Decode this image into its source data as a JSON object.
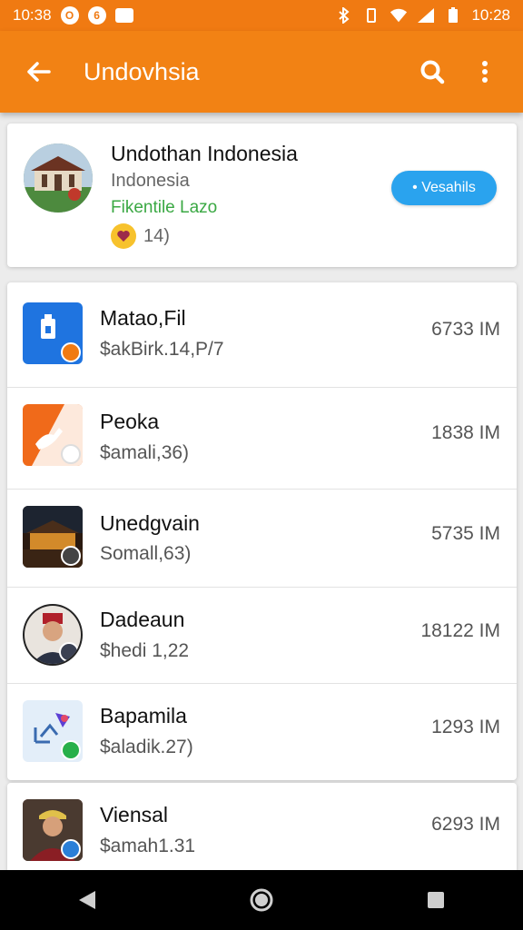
{
  "status_bar": {
    "time_left": "10:38",
    "time_right": "10:28"
  },
  "app_bar": {
    "title": "Undovhsia"
  },
  "profile": {
    "name": "Undothan Indonesia",
    "country": "Indonesia",
    "status": "Fikentile Lazo",
    "rating": "14)",
    "follow_label": "• Vesahils"
  },
  "items": [
    {
      "name": "Matao,Fil",
      "sub": "$akBirk.14,P/7",
      "size": "6733 IM"
    },
    {
      "name": "Peoka",
      "sub": "$amali,36)",
      "size": "1838 IM"
    },
    {
      "name": "Unedgvain",
      "sub": "Somall,63)",
      "size": "5735 IM"
    },
    {
      "name": "Dadeaun",
      "sub": "$hedi 1,22",
      "size": "18122 IM"
    },
    {
      "name": "Bapamila",
      "sub": "$aladik.27)",
      "size": "1293 IM"
    },
    {
      "name": "Viensal",
      "sub": "$amah1.31",
      "size": "6293 IM"
    }
  ],
  "colors": {
    "accent": "#f28214",
    "status_green": "#3aa843",
    "button_blue": "#2aa3ee"
  }
}
